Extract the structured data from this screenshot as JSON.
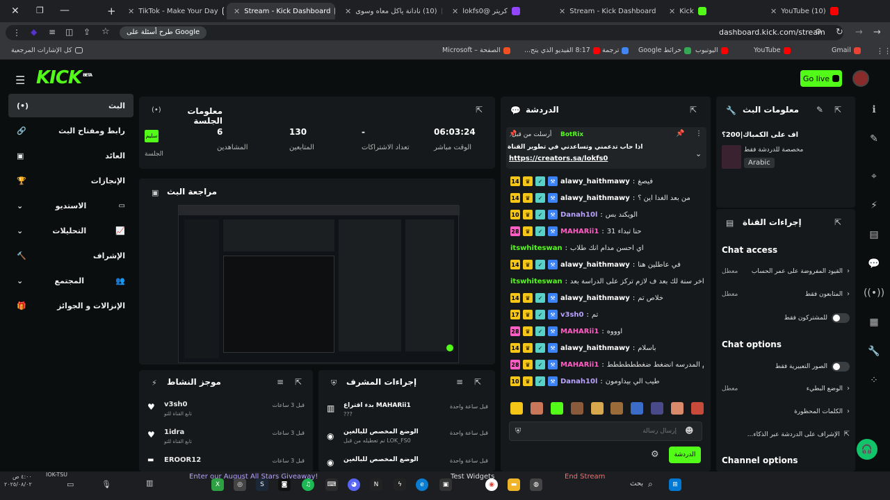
{
  "browser": {
    "tabs": [
      {
        "label": "TikTok - Make Your Day",
        "color": "#ffffff"
      },
      {
        "label": "Stream - Kick Dashboard",
        "color": "#53fc18"
      },
      {
        "label": "(10) نادانة ياكل معاه وسوى",
        "color": "#ff0000"
      },
      {
        "label": "كريتر @lokfs0",
        "color": "#9146ff"
      },
      {
        "label": "Stream - Kick Dashboard",
        "color": "#53fc18"
      },
      {
        "label": "Kick",
        "color": "#53fc18"
      },
      {
        "label": "(10) YouTube",
        "color": "#ff0000"
      }
    ],
    "search_hint": "طرح أسئلة على Google",
    "url": "dashboard.kick.com/stream",
    "bookmarks": [
      "Gmail",
      "YouTube",
      "اليوتيوب",
      "خرائط Google",
      "ترجمة",
      "8:17 الفيديو الذي يتح...",
      "الصفحة – Microsoft",
      "كل الإشارات المرجعية"
    ]
  },
  "header": {
    "logo": "KICK",
    "logo_badge": "BETA",
    "go_live": "Go live"
  },
  "sidebar": {
    "items": [
      {
        "label": "البث",
        "icon": "broadcast-icon"
      },
      {
        "label": "رابط ومفتاح البث",
        "icon": "link-icon"
      },
      {
        "label": "العائد",
        "icon": "revenue-icon"
      },
      {
        "label": "الإنجازات",
        "icon": "trophy-icon"
      },
      {
        "label": "الاستديو",
        "icon": "studio-icon"
      },
      {
        "label": "التحليلات",
        "icon": "analytics-icon"
      },
      {
        "label": "الإشراف",
        "icon": "moderation-icon"
      },
      {
        "label": "المجتمع",
        "icon": "community-icon"
      },
      {
        "label": "الإنزالات و الجوائز",
        "icon": "drops-icon"
      }
    ]
  },
  "session": {
    "title": "معلومات الجلسة",
    "status_badge": "سليم",
    "status_label": "الجلسة",
    "stats": [
      {
        "value": "6",
        "label": "المشاهدين"
      },
      {
        "value": "130",
        "label": "المتابعين"
      },
      {
        "value": "-",
        "label": "تعداد الاشتراكات"
      },
      {
        "value": "06:03:24",
        "label": "الوقت مباشر"
      }
    ]
  },
  "preview": {
    "title": "مراجعة البث"
  },
  "activity": {
    "title": "موجز النشاط",
    "items": [
      {
        "user": "v3sh0",
        "desc": "تابع القناة للتو",
        "time": "قبل 3 ساعات"
      },
      {
        "user": "1idra",
        "desc": "تابع القناة للتو",
        "time": "قبل 3 ساعات"
      },
      {
        "user": "EROOR12",
        "desc": "",
        "time": "قبل 3 ساعات"
      }
    ]
  },
  "modactions": {
    "title": "إجراءات المشرف",
    "items": [
      {
        "title": "بدء اقتراع MAHARii1",
        "sub": "???",
        "time": "قبل ساعة واحدة"
      },
      {
        "title": "الوضع المخصص للبالغين",
        "sub": "تم تعطيله من قبل LOK_FS0",
        "time": "قبل ساعة واحدة"
      },
      {
        "title": "الوضع المخصص للبالغين",
        "sub": "",
        "time": "قبل ساعة واحدة"
      }
    ]
  },
  "chat": {
    "title": "الدردشة",
    "pinned": {
      "by": "أرسلت من قبل",
      "user": "BotRix",
      "text": "اذا حاب تدعمني وتساعدني في تطوير القناة",
      "link": "https://creators.sa/lokfs0"
    },
    "messages": [
      {
        "badge": "14",
        "badge_color": "#f5c518",
        "user": "alawy_haithmawy",
        "color": "#ffffff",
        "text": "فيصغ"
      },
      {
        "badge": "14",
        "badge_color": "#f5c518",
        "user": "alawy_haithmawy",
        "color": "#ffffff",
        "text": "من بعد الغدا اين ؟"
      },
      {
        "badge": "10",
        "badge_color": "#f5c518",
        "user": "Danah10l",
        "color": "#b9a3ff",
        "text": "الويكند بس"
      },
      {
        "badge": "28",
        "badge_color": "#ff5ec4",
        "user": "MAHARii1",
        "color": "#ff5ec4",
        "text": "حنا تبداء 31"
      },
      {
        "badge": "",
        "badge_color": "",
        "user": "itswhiteswan",
        "color": "#53fc18",
        "text": "اي احسن مدام انك طلاب"
      },
      {
        "badge": "14",
        "badge_color": "#f5c518",
        "user": "alawy_haithmawy",
        "color": "#ffffff",
        "text": "في عاطلين هنا"
      },
      {
        "badge": "",
        "badge_color": "",
        "user": "itswhiteswan",
        "color": "#53fc18",
        "text": "واخر سنة لك بعد ف لازم تركز على الدراسة بعد"
      },
      {
        "badge": "14",
        "badge_color": "#f5c518",
        "user": "alawy_haithmawy",
        "color": "#ffffff",
        "text": "خلاص تم"
      },
      {
        "badge": "17",
        "badge_color": "#f5c518",
        "user": "v3sh0",
        "color": "#b9a3ff",
        "text": "تم"
      },
      {
        "badge": "28",
        "badge_color": "#ff5ec4",
        "user": "MAHARii1",
        "color": "#ff5ec4",
        "text": "اوووه"
      },
      {
        "badge": "14",
        "badge_color": "#f5c518",
        "user": "alawy_haithmawy",
        "color": "#ffffff",
        "text": "باسلام"
      },
      {
        "badge": "28",
        "badge_color": "#ff5ec4",
        "user": "MAHARii1",
        "color": "#ff5ec4",
        "text": "أنا ايام المدرسه انضغط ضغطططططط"
      },
      {
        "badge": "10",
        "badge_color": "#f5c518",
        "user": "Danah10l",
        "color": "#b9a3ff",
        "text": "طيب الي بيداومون"
      }
    ],
    "input_placeholder": "إرسال رسالة",
    "send_label": "الدردشة"
  },
  "stream_info": {
    "title": "معلومات البث",
    "stream_title": "اف على الكمباك|200؟",
    "subtitle": "مخصصة للدردشة فقط",
    "language": "Arabic"
  },
  "channel_actions": {
    "title": "إجراءات القناة",
    "chat_access": "Chat access",
    "access_rows": [
      {
        "label": "القيود المفروضة على عمر الحساب",
        "value": "معطل",
        "control": "chevron"
      },
      {
        "label": "المتابعون فقط",
        "value": "معطل",
        "control": "chevron"
      },
      {
        "label": "للمشتركون فقط",
        "value": "",
        "control": "toggle"
      }
    ],
    "chat_options": "Chat options",
    "option_rows": [
      {
        "label": "الصور التعبيرية فقط",
        "value": "",
        "control": "toggle"
      },
      {
        "label": "الوضع البطيء",
        "value": "معطل",
        "control": "chevron"
      },
      {
        "label": "الكلمات المحظورة",
        "value": "",
        "control": "chevron"
      },
      {
        "label": "الإشراف على الدردشة عبر الذكاء...",
        "value": "",
        "control": "external"
      }
    ],
    "channel_options": "Channel options"
  },
  "taskbar": {
    "weather": "IOK-TSU",
    "promo": "Enter our August All Stars Giveaway!",
    "test_widgets": "Test Widgets",
    "end_stream": "End Stream",
    "search": "بحث",
    "time": "٤:٠٠ ص",
    "date": "٢٠٢٥/٠٨/٠٢"
  }
}
